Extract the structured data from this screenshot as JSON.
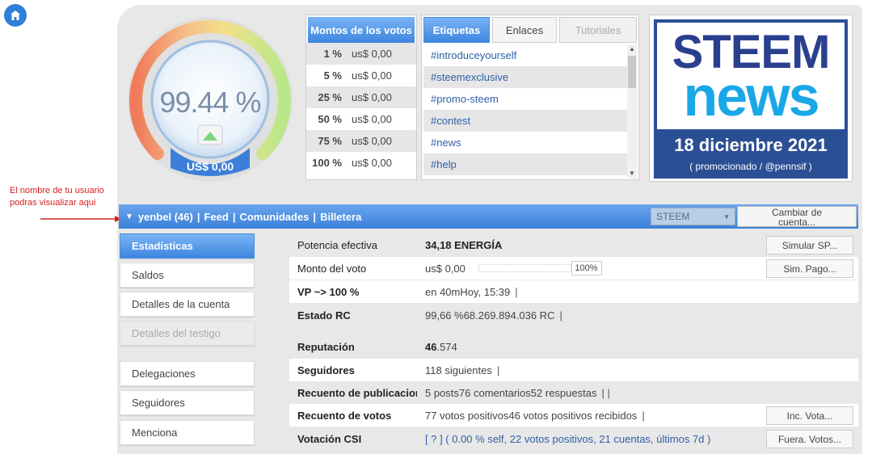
{
  "gauge": {
    "percent": "99.44 %",
    "usd": "US$ 0,00"
  },
  "vote_amounts": {
    "header": "Montos de los votos",
    "rows": [
      {
        "pct": "1 %",
        "amt": "us$ 0,00"
      },
      {
        "pct": "5 %",
        "amt": "us$ 0,00"
      },
      {
        "pct": "25 %",
        "amt": "us$ 0,00"
      },
      {
        "pct": "50 %",
        "amt": "us$ 0,00"
      },
      {
        "pct": "75 %",
        "amt": "us$ 0,00"
      },
      {
        "pct": "100 %",
        "amt": "us$ 0,00"
      }
    ]
  },
  "tabs": [
    {
      "label": "Etiquetas"
    },
    {
      "label": "Enlaces"
    },
    {
      "label": "Tutoriales"
    }
  ],
  "tags": [
    "#introduceyourself",
    "#steemexclusive",
    "#promo-steem",
    "#contest",
    "#news",
    "#help"
  ],
  "news": {
    "logo_line1": "STEEM",
    "logo_line2": "news",
    "date": "18 diciembre 2021",
    "subtitle": "( promocionado / @pennsif )"
  },
  "annotation": {
    "line1": "El nombre de tu usuario",
    "line2": "podras visualizar aqui"
  },
  "userbar": {
    "user": "yenbel (46)",
    "sep": "|",
    "feed": "Feed",
    "comunidades": "Comunidades",
    "billetera": "Billetera",
    "currency": "STEEM",
    "cambiar_line1": "Cambiar de",
    "cambiar_line2": "cuenta..."
  },
  "menu": [
    "Estadísticas",
    "Saldos",
    "Detalles de la cuenta",
    "Detalles del testigo",
    "Delegaciones",
    "Seguidores",
    "Menciona"
  ],
  "stats": {
    "potencia": {
      "label": "Potencia efectiva",
      "value": "34,18 ENERGÍA",
      "button": "Simular SP..."
    },
    "monto": {
      "label": "Monto del voto",
      "value": "us$ 0,00",
      "pct": "100%",
      "button": "Sim. Pago..."
    },
    "vp": {
      "label": "VP ~> 100 %",
      "value": "en 40mHoy, 15:39",
      "pipe": "|"
    },
    "rc": {
      "label": "Estado RC",
      "value": "99,66 %68.269.894.036 RC",
      "pipe": "|"
    },
    "reputacion": {
      "label": "Reputación",
      "value_bold": "46",
      "value_rest": ".574"
    },
    "seguidores": {
      "label": "Seguidores",
      "value": "118 siguientes",
      "pipe": "|"
    },
    "publicaciones": {
      "label": "Recuento de publicaciones",
      "value": "5 posts76 comentarios52 respuestas",
      "pipe": "|    |"
    },
    "votos": {
      "label": "Recuento de votos",
      "value": "77 votos positivos46 votos positivos recibidos",
      "pipe": "|",
      "button": "Inc. Vota..."
    },
    "csi": {
      "label": "Votación CSI",
      "value": "[ ? ] ( 0.00 % self, 22 votos positivos, 21 cuentas, últimos 7d )",
      "button": "Fuera. Votos..."
    }
  }
}
